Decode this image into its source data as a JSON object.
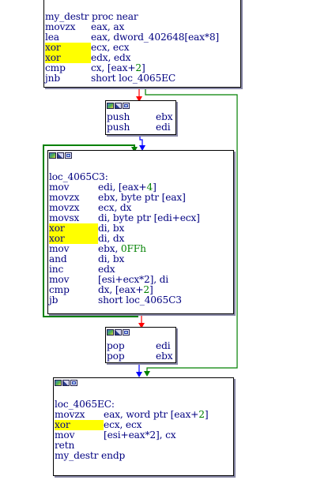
{
  "colors": {
    "background": "#ffffff",
    "edge_true": "#008000",
    "edge_false": "#ff0000",
    "edge_normal": "#0000ff",
    "text": "#000080",
    "constant": "#008000",
    "highlight": "#ffff00"
  },
  "block_header_icons": [
    "color-icon",
    "graph-icon",
    "text-view-icon"
  ],
  "blocks": [
    {
      "id": "b1",
      "lines": [
        {
          "m": "my_destr proc near",
          "o": ""
        },
        {
          "m": "movzx",
          "o": "eax, ax"
        },
        {
          "m": "lea",
          "o": "eax, dword_402648[eax*8]"
        },
        {
          "m": "xor",
          "o": "ecx, ecx"
        },
        {
          "m": "xor",
          "o": "edx, edx"
        },
        {
          "m": "cmp",
          "o": "cx, [eax+2]"
        },
        {
          "m": "jnb",
          "o": "short loc_4065EC"
        }
      ]
    },
    {
      "id": "b2",
      "lines": [
        {
          "m": "push",
          "o": "ebx"
        },
        {
          "m": "push",
          "o": "edi"
        }
      ]
    },
    {
      "id": "b3",
      "lines": [
        {
          "m": "",
          "o": ""
        },
        {
          "m": "loc_4065C3:",
          "o": ""
        },
        {
          "m": "mov",
          "o": "edi, [eax+4]"
        },
        {
          "m": "movzx",
          "o": "ebx, byte ptr [eax]"
        },
        {
          "m": "movzx",
          "o": "ecx, dx"
        },
        {
          "m": "movsx",
          "o": "di, byte ptr [edi+ecx]"
        },
        {
          "m": "xor",
          "o": "di, bx"
        },
        {
          "m": "xor",
          "o": "di, dx"
        },
        {
          "m": "mov",
          "o": "ebx, 0FFh"
        },
        {
          "m": "and",
          "o": "di, bx"
        },
        {
          "m": "inc",
          "o": "edx"
        },
        {
          "m": "mov",
          "o": "[esi+ecx*2], di"
        },
        {
          "m": "cmp",
          "o": "dx, [eax+2]"
        },
        {
          "m": "jb",
          "o": "short loc_4065C3"
        }
      ]
    },
    {
      "id": "b4",
      "lines": [
        {
          "m": "pop",
          "o": "edi"
        },
        {
          "m": "pop",
          "o": "ebx"
        }
      ]
    },
    {
      "id": "b5",
      "lines": [
        {
          "m": "",
          "o": ""
        },
        {
          "m": "loc_4065EC:",
          "o": ""
        },
        {
          "m": "movzx",
          "o": "eax, word ptr [eax+2]"
        },
        {
          "m": "xor",
          "o": "ecx, ecx"
        },
        {
          "m": "mov",
          "o": "[esi+eax*2], cx"
        },
        {
          "m": "retn",
          "o": ""
        },
        {
          "m": "my_destr endp",
          "o": ""
        }
      ]
    }
  ]
}
